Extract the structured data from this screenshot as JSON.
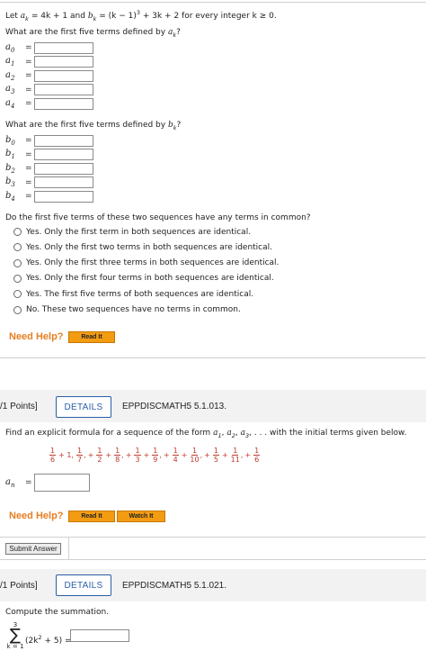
{
  "q1": {
    "intro_let": "Let",
    "intro_def_a": "= 4k + 1 and",
    "intro_def_b": "= (k − 1)",
    "intro_def_b_exp": "3",
    "intro_def_b_tail": "+ 3k + 2 for every integer k ≥ 0.",
    "prompt_a": "What are the first five terms defined by",
    "prompt_b": "What are the first five terms defined by",
    "a_label": "a",
    "b_label": "b",
    "k_sub": "k",
    "question_mark": "?",
    "equals": "=",
    "a_terms": [
      {
        "sub": "0",
        "value": ""
      },
      {
        "sub": "1",
        "value": ""
      },
      {
        "sub": "2",
        "value": ""
      },
      {
        "sub": "3",
        "value": ""
      },
      {
        "sub": "4",
        "value": ""
      }
    ],
    "b_terms": [
      {
        "sub": "0",
        "value": ""
      },
      {
        "sub": "1",
        "value": ""
      },
      {
        "sub": "2",
        "value": ""
      },
      {
        "sub": "3",
        "value": ""
      },
      {
        "sub": "4",
        "value": ""
      }
    ],
    "common_prompt": "Do the first five terms of these two sequences have any terms in common?",
    "options": [
      "Yes. Only the first term in both sequences are identical.",
      "Yes. Only the first two terms in both sequences are identical.",
      "Yes. Only the first three terms in both sequences are identical.",
      "Yes. Only the first four terms in both sequences are identical.",
      "Yes. The first five terms of both sequences are identical.",
      "No. These two sequences have no terms in common."
    ],
    "need_help": "Need Help?",
    "read_it": "Read It"
  },
  "q2": {
    "points": "/1 Points]",
    "details": "DETAILS",
    "code": "EPPDISCMATH5 5.1.013.",
    "prompt": "Find an explicit formula for a sequence of the form",
    "prompt_tail": "with the initial terms given below.",
    "form_terms": [
      "a",
      "a",
      "a"
    ],
    "form_subs": [
      "1",
      "2",
      "3"
    ],
    "ellipsis": ", . . .",
    "sequence": [
      {
        "n": "1",
        "d": "6"
      },
      {
        "n": "1",
        "d": "7"
      },
      {
        "n": "1",
        "d": "2"
      },
      {
        "n": "1",
        "d": "8"
      },
      {
        "n": "1",
        "d": "3"
      },
      {
        "n": "1",
        "d": "9"
      },
      {
        "n": "1",
        "d": "4"
      },
      {
        "n": "1",
        "d": "10"
      },
      {
        "n": "1",
        "d": "5"
      },
      {
        "n": "1",
        "d": "11"
      },
      {
        "n": "1",
        "d": "6"
      }
    ],
    "plus": "+",
    "one": "1",
    "comma": ",",
    "answer_label": "a",
    "answer_sub": "n",
    "answer_value": "",
    "need_help": "Need Help?",
    "read_it": "Read It",
    "watch_it": "Watch It",
    "submit": "Submit Answer"
  },
  "q3": {
    "points": "/1 Points]",
    "details": "DETAILS",
    "code": "EPPDISCMATH5 5.1.021.",
    "prompt": "Compute the summation.",
    "sigma": "∑",
    "upper": "3",
    "lower": "k = 1",
    "expr": "(2k",
    "expr_exp": "2",
    "expr_tail": "+ 5)",
    "answer_value": ""
  }
}
